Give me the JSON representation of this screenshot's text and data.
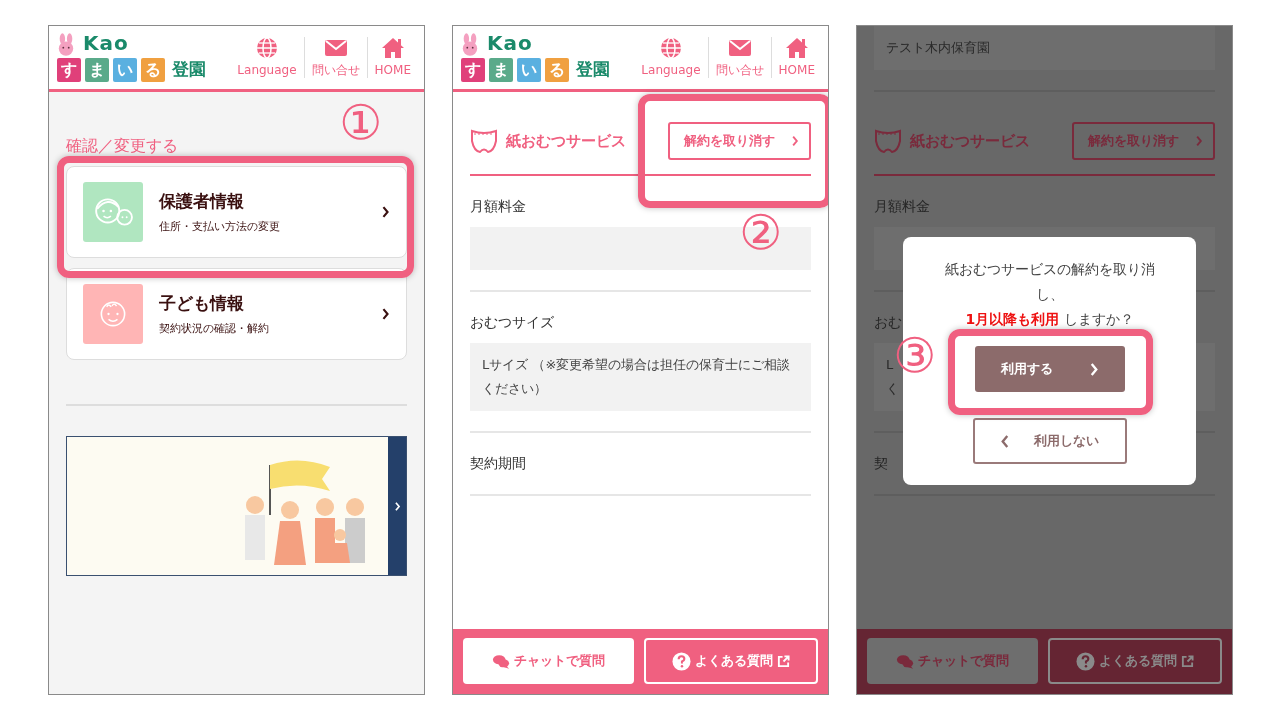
{
  "screens": [
    {
      "dimmed": false,
      "header": {
        "logo": {
          "brand": "Kao",
          "tiles": [
            {
              "char": "す",
              "color": "#e0407a"
            },
            {
              "char": "ま",
              "color": "#5aaa8a"
            },
            {
              "char": "い",
              "color": "#5ab0e0"
            },
            {
              "char": "る",
              "color": "#f0a040"
            }
          ],
          "suffix": "登園"
        },
        "nav": [
          "Language",
          "問い合せ",
          "HOME"
        ]
      },
      "kind": "menu",
      "section_title": "確認／変更する",
      "menu_items": [
        {
          "title": "保護者情報",
          "subtitle": "住所・支払い方法の変更",
          "color": "#b0e6c0"
        },
        {
          "title": "子ども情報",
          "subtitle": "契約状況の確認・解約",
          "color": "#ffb5b5"
        }
      ],
      "annotation": "①"
    },
    {
      "dimmed": false,
      "header": {
        "logo": {
          "brand": "Kao",
          "tiles": [
            {
              "char": "す",
              "color": "#e0407a"
            },
            {
              "char": "ま",
              "color": "#5aaa8a"
            },
            {
              "char": "い",
              "color": "#5ab0e0"
            },
            {
              "char": "る",
              "color": "#f0a040"
            }
          ],
          "suffix": "登園"
        },
        "nav": [
          "Language",
          "問い合せ",
          "HOME"
        ]
      },
      "kind": "detail",
      "blocks": [
        {
          "kind": "section",
          "title": "紙おむつサービス",
          "button": "解約を取り消す"
        },
        {
          "kind": "field",
          "label": "月額料金",
          "box": true
        },
        {
          "kind": "field",
          "label": "おむつサイズ",
          "box": true,
          "value": "Lサイズ （※変更希望の場合は担任の保育士にご相談ください）"
        },
        {
          "kind": "field",
          "label": "契約期間",
          "box": false
        }
      ],
      "footer": [
        {
          "kind": "chat",
          "label": "チャットで質問"
        },
        {
          "kind": "faq",
          "label": "よくある質問"
        }
      ],
      "annotation": "②"
    },
    {
      "dimmed": true,
      "kind": "detail",
      "blocks": [
        {
          "kind": "field",
          "box": true,
          "value": "テスト木内保育園"
        },
        {
          "kind": "section",
          "title": "紙おむつサービス",
          "button": "解約を取り消す"
        },
        {
          "kind": "field",
          "label": "月額料金",
          "box": true
        },
        {
          "kind": "field",
          "label": "おむ",
          "box": true,
          "value_lines": [
            "L",
            "く"
          ]
        },
        {
          "kind": "field",
          "label": "契",
          "box": false
        }
      ],
      "footer": [
        {
          "kind": "chat",
          "label": "チャットで質問"
        },
        {
          "kind": "faq",
          "label": "よくある質問"
        }
      ],
      "dialog": {
        "message": "紙おむつサービスの解約を取り消し、",
        "highlight": "1月以降も利用",
        "message_after": " しますか？",
        "buttons": [
          {
            "kind": "primary",
            "label": "利用する"
          },
          {
            "kind": "secondary",
            "label": "利用しない"
          }
        ]
      },
      "annotation": "③"
    }
  ]
}
